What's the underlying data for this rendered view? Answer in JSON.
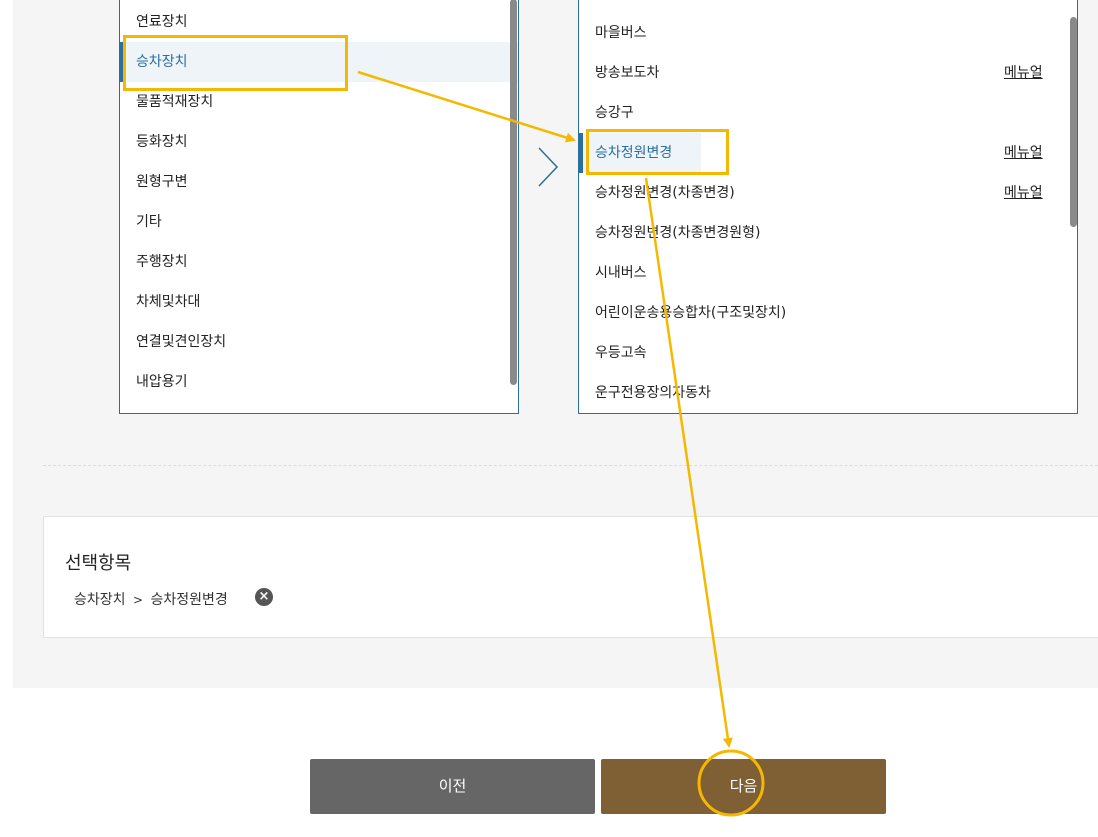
{
  "left_list": {
    "items": [
      {
        "label": "연료장치",
        "active": false
      },
      {
        "label": "승차장치",
        "active": true
      },
      {
        "label": "물품적재장치",
        "active": false
      },
      {
        "label": "등화장치",
        "active": false
      },
      {
        "label": "원형구변",
        "active": false
      },
      {
        "label": "기타",
        "active": false
      },
      {
        "label": "주행장치",
        "active": false
      },
      {
        "label": "차체및차대",
        "active": false
      },
      {
        "label": "연결및견인장치",
        "active": false
      },
      {
        "label": "내압용기",
        "active": false
      }
    ]
  },
  "right_list": {
    "items": [
      {
        "label": "마을버스",
        "manual": ""
      },
      {
        "label": "방송보도차",
        "manual": "메뉴얼"
      },
      {
        "label": "승강구",
        "manual": ""
      },
      {
        "label": "승차정원변경",
        "manual": "메뉴얼",
        "active": true
      },
      {
        "label": "승차정원변경(차종변경)",
        "manual": "메뉴얼"
      },
      {
        "label": "승차정원변경(차종변경원형)",
        "manual": ""
      },
      {
        "label": "시내버스",
        "manual": ""
      },
      {
        "label": "어린이운송용승합차(구조및장치)",
        "manual": ""
      },
      {
        "label": "우등고속",
        "manual": ""
      },
      {
        "label": "운구전용장의자동차",
        "manual": ""
      }
    ]
  },
  "selected": {
    "title": "선택항목",
    "path_first": "승차장치",
    "separator": ">",
    "path_second": "승차정원변경"
  },
  "buttons": {
    "prev": "이전",
    "next": "다음"
  },
  "colors": {
    "accent": "#2b6f9e",
    "highlight": "#f5b800",
    "next_button": "#7f5f34",
    "prev_button": "#666666"
  },
  "icons": [
    "chevron-right-icon",
    "remove-icon"
  ]
}
